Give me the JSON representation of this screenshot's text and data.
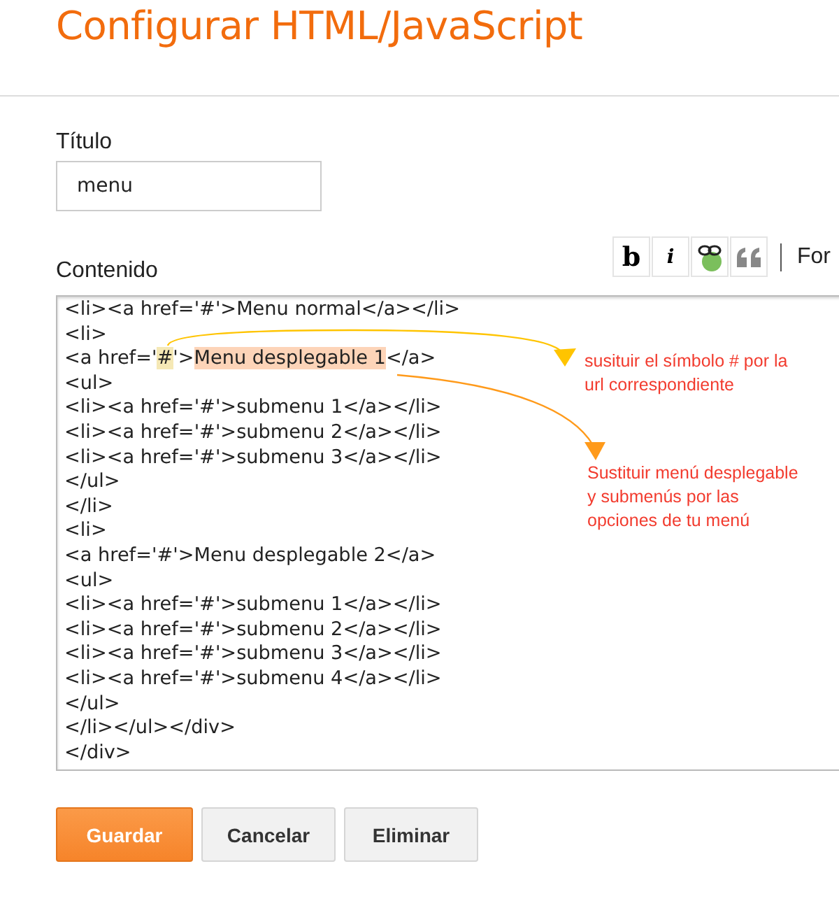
{
  "page_title": "Configurar HTML/JavaScript",
  "title_field": {
    "label": "Título",
    "value": "menu"
  },
  "content": {
    "label": "Contenido",
    "toolbar": [
      {
        "kind": "bold",
        "text": "b"
      },
      {
        "kind": "italic",
        "text": "i"
      },
      {
        "kind": "link"
      },
      {
        "kind": "quote"
      }
    ],
    "toolbar_more": "For",
    "lines": [
      [
        {
          "text": "<li><a href='#'>Menu normal</a></li>",
          "kind": "plain"
        }
      ],
      [
        {
          "text": "<li>",
          "kind": "plain"
        }
      ],
      [
        {
          "text": "<a href='",
          "kind": "plain"
        },
        {
          "text": "#",
          "kind": "hash"
        },
        {
          "text": "'>",
          "kind": "plain"
        },
        {
          "text": "Menu desplegable 1",
          "kind": "phrase"
        },
        {
          "text": "</a>",
          "kind": "plain"
        }
      ],
      [
        {
          "text": "<ul>",
          "kind": "plain"
        }
      ],
      [
        {
          "text": "<li><a href='#'>submenu 1</a></li>",
          "kind": "plain"
        }
      ],
      [
        {
          "text": "<li><a href='#'>submenu 2</a></li>",
          "kind": "plain"
        }
      ],
      [
        {
          "text": "<li><a href='#'>submenu 3</a></li>",
          "kind": "plain"
        }
      ],
      [
        {
          "text": "</ul>",
          "kind": "plain"
        }
      ],
      [
        {
          "text": "</li>",
          "kind": "plain"
        }
      ],
      [
        {
          "text": "<li>",
          "kind": "plain"
        }
      ],
      [
        {
          "text": "<a href='#'>Menu desplegable 2</a>",
          "kind": "plain"
        }
      ],
      [
        {
          "text": "<ul>",
          "kind": "plain"
        }
      ],
      [
        {
          "text": "<li><a href='#'>submenu 1</a></li>",
          "kind": "plain"
        }
      ],
      [
        {
          "text": "<li><a href='#'>submenu 2</a></li>",
          "kind": "plain"
        }
      ],
      [
        {
          "text": "<li><a href='#'>submenu 3</a></li>",
          "kind": "plain"
        }
      ],
      [
        {
          "text": "<li><a href='#'>submenu 4</a></li>",
          "kind": "plain"
        }
      ],
      [
        {
          "text": "</ul>",
          "kind": "plain"
        }
      ],
      [
        {
          "text": "</li></ul></div>",
          "kind": "plain"
        }
      ],
      [
        {
          "text": "</div>",
          "kind": "plain"
        }
      ]
    ]
  },
  "annotations": [
    {
      "text": "susituir el símbolo # por la url correspondiente",
      "color": "#ffc400"
    },
    {
      "text": "Sustituir menú desplegable y submenús por las opciones de tu menú",
      "color": "#ff9a1a"
    }
  ],
  "buttons": [
    {
      "label": "Guardar",
      "kind": "primary"
    },
    {
      "label": "Cancelar",
      "kind": "default"
    },
    {
      "label": "Eliminar",
      "kind": "default"
    }
  ]
}
